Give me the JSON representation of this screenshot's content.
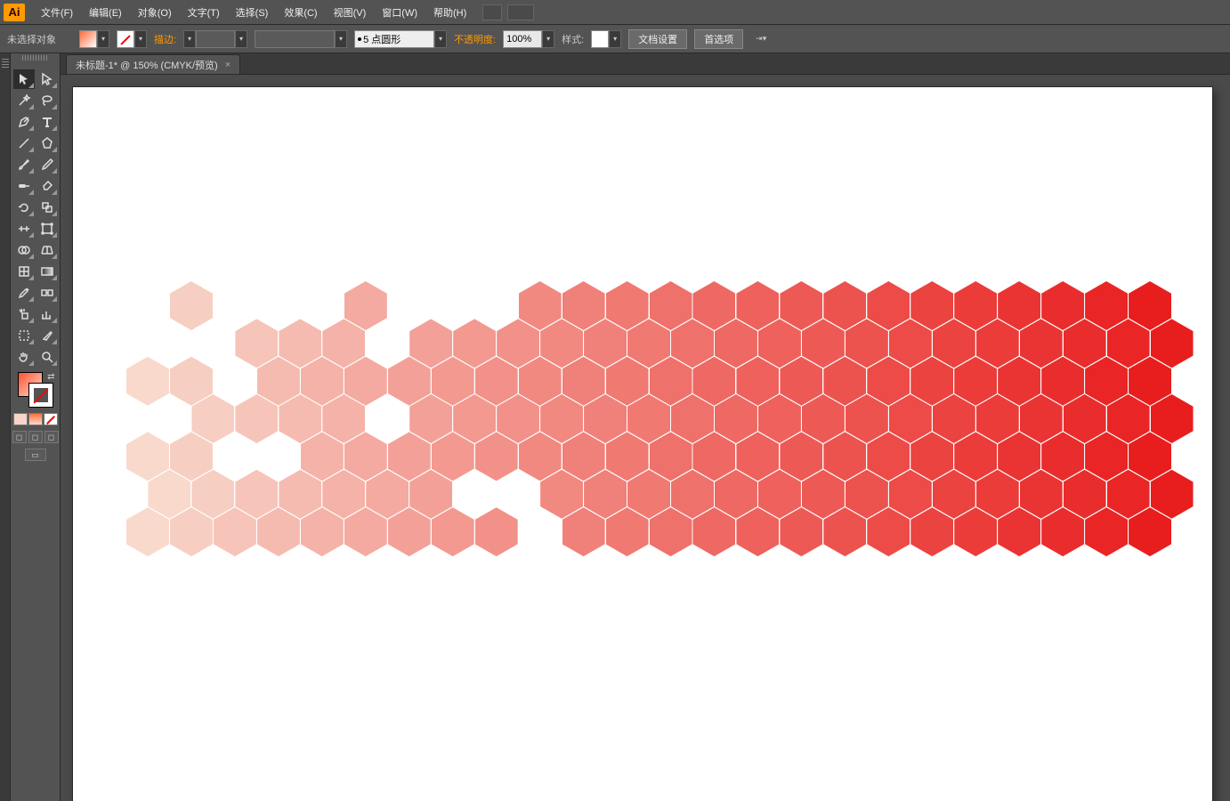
{
  "app": {
    "logo": "Ai"
  },
  "menu": {
    "file": "文件(F)",
    "edit": "编辑(E)",
    "object": "对象(O)",
    "type": "文字(T)",
    "select": "选择(S)",
    "effect": "效果(C)",
    "view": "视图(V)",
    "window": "窗口(W)",
    "help": "帮助(H)"
  },
  "optbar": {
    "selection": "未选择对象",
    "stroke_label": "描边:",
    "stroke_profile": "5 点圆形",
    "opacity_label": "不透明度:",
    "opacity_value": "100%",
    "style_label": "样式:",
    "doc_setup": "文档设置",
    "prefs": "首选项"
  },
  "doc": {
    "tab": "未标题-1* @ 150% (CMYK/预览)"
  },
  "hex_colors": {
    "start": "#f8d9cc",
    "end": "#e81e1e"
  },
  "hex_missing": [
    [
      0,
      0
    ],
    [
      0,
      1
    ],
    [
      0,
      3
    ],
    [
      1,
      1
    ],
    [
      2,
      0
    ],
    [
      2,
      2
    ],
    [
      2,
      4
    ],
    [
      3,
      0
    ],
    [
      3,
      4
    ],
    [
      4,
      0
    ],
    [
      5,
      1
    ],
    [
      5,
      3
    ],
    [
      6,
      0
    ],
    [
      7,
      0
    ],
    [
      7,
      5
    ],
    [
      8,
      0
    ],
    [
      8,
      5
    ],
    [
      9,
      6
    ]
  ]
}
